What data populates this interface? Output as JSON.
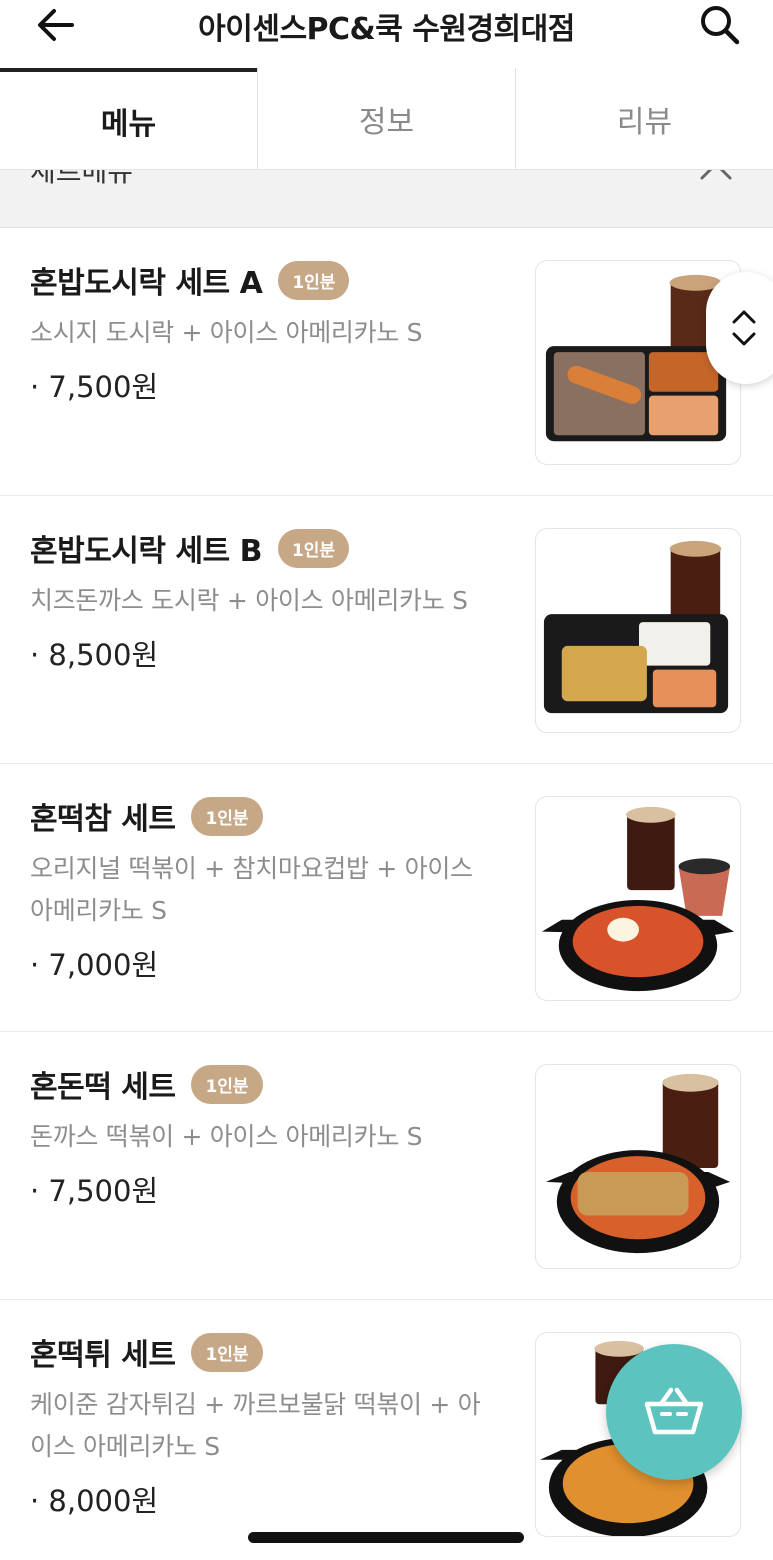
{
  "header": {
    "title": "아이센스PC&쿡 수원경희대점",
    "back_icon": "back-arrow-icon",
    "search_icon": "search-icon"
  },
  "tabs": [
    {
      "label": "메뉴",
      "active": true
    },
    {
      "label": "정보",
      "active": false
    },
    {
      "label": "리뷰",
      "active": false
    }
  ],
  "section": {
    "title": "세트메뉴"
  },
  "menu_items": [
    {
      "name": "혼밥도시락 세트 A",
      "badge": "1인분",
      "desc": "소시지 도시락 + 아이스 아메리카노 S",
      "price": "· 7,500원"
    },
    {
      "name": "혼밥도시락 세트 B",
      "badge": "1인분",
      "desc": "치즈돈까스 도시락 + 아이스 아메리카노 S",
      "price": "· 8,500원"
    },
    {
      "name": "혼떡참 세트",
      "badge": "1인분",
      "desc": "오리지널 떡볶이 + 참치마요컵밥 + 아이스 아메리카노 S",
      "price": "· 7,000원"
    },
    {
      "name": "혼돈떡 세트",
      "badge": "1인분",
      "desc": "돈까스 떡볶이 + 아이스 아메리카노 S",
      "price": "· 7,500원"
    },
    {
      "name": "혼떡튀 세트",
      "badge": "1인분",
      "desc": "케이준 감자튀김 + 까르보불닭 떡볶이 + 아이스 아메리카노 S",
      "price": "· 8,000원"
    }
  ],
  "colors": {
    "badge": "#c7a886",
    "cart_fab": "#5dc3bf"
  }
}
